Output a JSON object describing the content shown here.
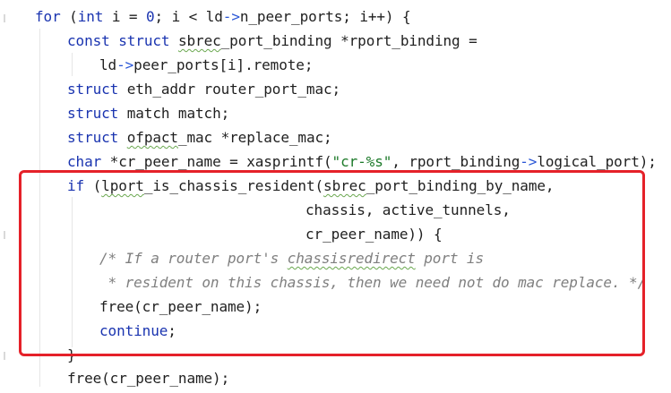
{
  "code": {
    "l1": {
      "kw_for": "for",
      "t1": " (",
      "kw_int": "int",
      "t2": " i = ",
      "n0": "0",
      "t3": "; i < ld",
      "arrow": "->",
      "t4": "n_peer_ports; i++) {"
    },
    "l2": {
      "kw_const": "const",
      "sp1": " ",
      "kw_struct": "struct",
      "sp2": " ",
      "type": "sbrec",
      "t1": "_port_binding *rport_binding ="
    },
    "l3": {
      "t1": "ld",
      "arrow": "->",
      "t2": "peer_ports[i].remote;"
    },
    "l4": {
      "kw_struct": "struct",
      "t1": " eth_addr router_port_mac;"
    },
    "l5": {
      "kw_struct": "struct",
      "t1": " match match;"
    },
    "l6": {
      "kw_struct": "struct",
      "sp1": " ",
      "type": "ofpact",
      "t1": "_mac *replace_mac;"
    },
    "l7": {
      "kw_char": "char",
      "t1": " *cr_peer_name = xasprintf(",
      "str": "\"cr-%s\"",
      "t2": ", rport_binding",
      "arrow": "->",
      "t3": "logical_port);"
    },
    "l8": {
      "kw_if": "if",
      "t1": " (",
      "fn": "lport",
      "t2": "_is_chassis_resident(",
      "arg": "sbrec",
      "t3": "_port_binding_by_name,"
    },
    "l9": {
      "t1": "chassis, active_tunnels,"
    },
    "l10": {
      "t1": "cr_peer_name)) {"
    },
    "l11": {
      "c1": "/* If a router port's ",
      "typo": "chassisredirect",
      "c2": " port is"
    },
    "l12": {
      "c1": " * resident on this chassis, then we need not do mac replace. */"
    },
    "l13": {
      "t1": "free(cr_peer_name);"
    },
    "l14": {
      "kw_continue": "continue",
      "t1": ";"
    },
    "l15": {
      "t1": "}"
    },
    "l16": {
      "t1": "free(cr_peer_name);"
    }
  },
  "colors": {
    "keyword": "#1a34b0",
    "string": "#1d7a2a",
    "comment": "#7f7f7f",
    "highlight_box": "#e52129"
  }
}
